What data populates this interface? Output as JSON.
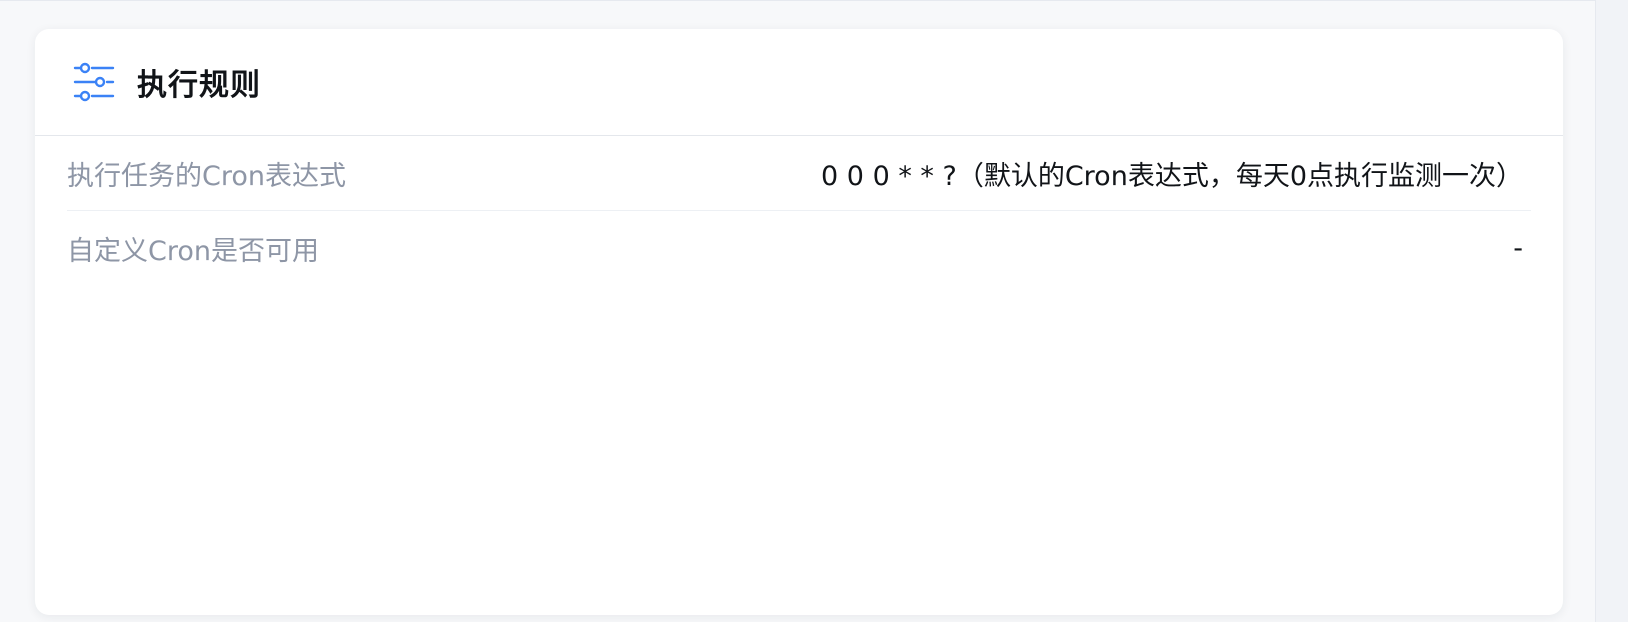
{
  "card": {
    "title": "执行规则",
    "icon": "sliders-icon",
    "accent_color": "#3b82f6"
  },
  "rules": [
    {
      "label": "执行任务的Cron表达式",
      "value": "0 0 0 * * ?（默认的Cron表达式，每天0点执行监测一次）"
    },
    {
      "label": "自定义Cron是否可用",
      "value": "-"
    }
  ]
}
